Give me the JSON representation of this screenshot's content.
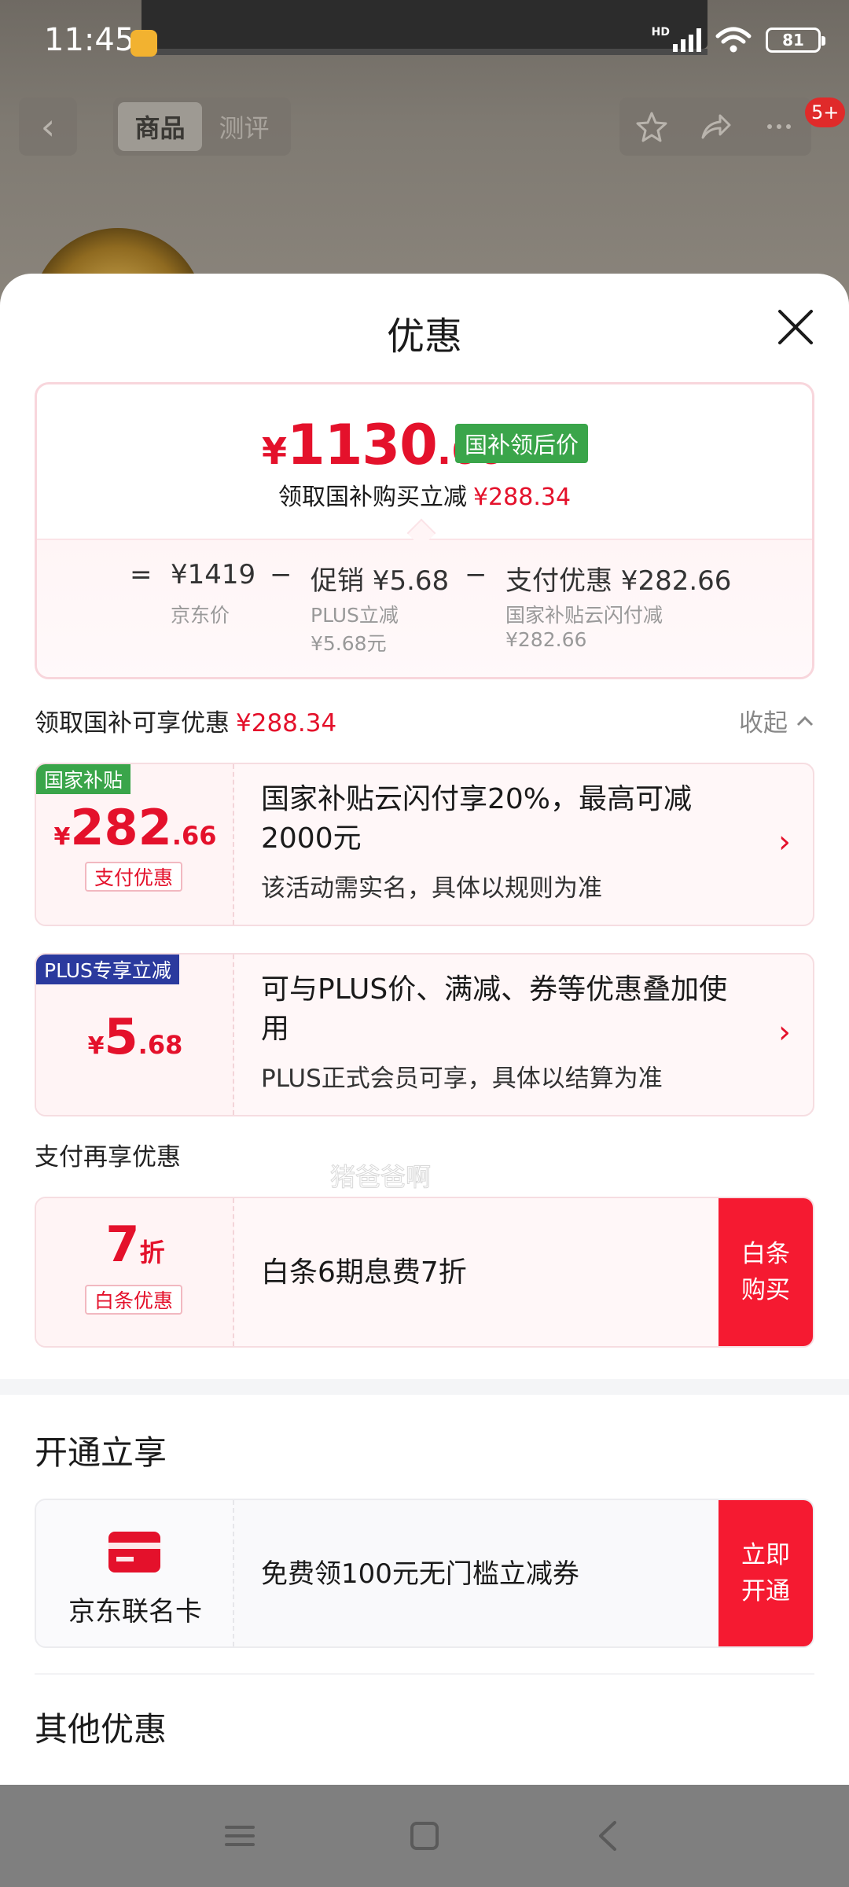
{
  "status": {
    "time": "11:45",
    "hd": "HD",
    "battery": "81"
  },
  "nav": {
    "tabs": [
      "商品",
      "测评"
    ],
    "badge": "5+"
  },
  "sheet": {
    "title": "优惠",
    "summary": {
      "yen": "¥",
      "price_int": "1130",
      "price_dec": ".66",
      "tag": "国补领后价",
      "line_text": "领取国补购买立减",
      "line_amount": "¥288.34",
      "calc": {
        "eq": "=",
        "base_value": "¥1419",
        "base_label": "京东价",
        "minus1": "−",
        "promo_value": "促销 ¥5.68",
        "promo_label": "PLUS立减",
        "promo_sub": "¥5.68元",
        "minus2": "−",
        "pay_value": "支付优惠 ¥282.66",
        "pay_label": "国家补贴云闪付减",
        "pay_sub": "¥282.66"
      }
    },
    "section1": {
      "title": "领取国补可享优惠",
      "amount": "¥288.34",
      "collapse": "收起"
    },
    "coupons": [
      {
        "tag": "国家补贴",
        "yen": "¥",
        "amount_int": "282",
        "amount_dec": ".66",
        "label": "支付优惠",
        "text": "国家补贴云闪付享20%，最高可减2000元",
        "sub": "该活动需实名，具体以规则为准"
      },
      {
        "tag": "PLUS专享立减",
        "yen": "¥",
        "amount_int": "5",
        "amount_dec": ".68",
        "text": "可与PLUS价、满减、券等优惠叠加使用",
        "sub": "PLUS正式会员可享，具体以结算为准"
      }
    ],
    "section2": {
      "title": "支付再享优惠"
    },
    "baitiao": {
      "discount": "7",
      "unit": "折",
      "label": "白条优惠",
      "text": "白条6期息费7折",
      "btn_line1": "白条",
      "btn_line2": "购买"
    },
    "section3": {
      "title": "开通立享"
    },
    "card": {
      "name": "京东联名卡",
      "text": "免费领100元无门槛立减券",
      "btn_line1": "立即",
      "btn_line2": "开通"
    },
    "section4": {
      "title": "其他优惠"
    },
    "watermark": "猪爸爸啊"
  },
  "colors": {
    "accent": "#e4112b",
    "tag_green": "#3aa54a",
    "tag_blue": "#2b3a9e",
    "button_red": "#f51a31"
  }
}
